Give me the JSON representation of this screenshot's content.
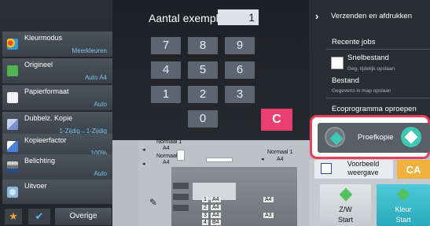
{
  "left_menu": [
    {
      "label": "Kleurmodus",
      "value": "Meerkleuren",
      "icon": "color-mode-icon",
      "icon_color": "#d94b9a"
    },
    {
      "label": "Origineel",
      "value": "Auto A4",
      "icon": "original-icon",
      "icon_color": "#4fb34f"
    },
    {
      "label": "Papierformaat",
      "value": "Auto",
      "icon": "paper-icon",
      "icon_color": "#f2f2f2"
    },
    {
      "label": "Dubbelz. Kopie",
      "value": "1-Zijdig→1-Zijdig",
      "icon": "duplex-icon",
      "icon_color": "#7a8fd0"
    },
    {
      "label": "Kopieerfactor",
      "value": "100%",
      "icon": "copy-ratio-icon",
      "icon_color": "#4a7fd8"
    },
    {
      "label": "Belichting",
      "value": "Auto",
      "icon": "exposure-icon",
      "icon_color": "#9aa3ad"
    },
    {
      "label": "Uitvoer",
      "value": "",
      "icon": "output-icon",
      "icon_color": "#8ab8d8"
    }
  ],
  "bottom_bar": {
    "overige_label": "Overige",
    "star_icon": "star-icon",
    "check_icon": "check-icon"
  },
  "copies": {
    "label": "Aantal exempl.",
    "value": "1"
  },
  "keypad": {
    "keys": [
      "7",
      "8",
      "9",
      "4",
      "5",
      "6",
      "1",
      "2",
      "3",
      "0"
    ],
    "clear_label": "C"
  },
  "preview": {
    "label_a": "Normaal 1",
    "size_a": "A4",
    "label_b": "Normaal 1",
    "size_b": "A4",
    "label_c": "Normaal 1",
    "size_c": "A4",
    "tray_labels": [
      "A4",
      "A4",
      "A4",
      "B4",
      "A4",
      "A3"
    ],
    "tray_numbers": [
      "1",
      "2",
      "3",
      "4"
    ]
  },
  "right_panel": {
    "send_print": "Verzenden en afdrukken",
    "recent_jobs": "Recente jobs",
    "quick_file": "Snelbestand",
    "quick_file_sub": "Geg. tijdelijk opslaan",
    "file": "Bestand",
    "file_sub": "Gegevens in map opslaan",
    "eco": "Ecoprogramma oproepen"
  },
  "proof_copy": {
    "label": "Proefkopie",
    "accent": "#3fc7b6"
  },
  "preview_button": {
    "label_line1": "Voorbeeld",
    "label_line2": "weergave"
  },
  "ca_button": {
    "label": "CA"
  },
  "start_bw": {
    "line1": "Z/W",
    "line2": "Start"
  },
  "start_color": {
    "line1": "Kleur",
    "line2": "Start"
  }
}
